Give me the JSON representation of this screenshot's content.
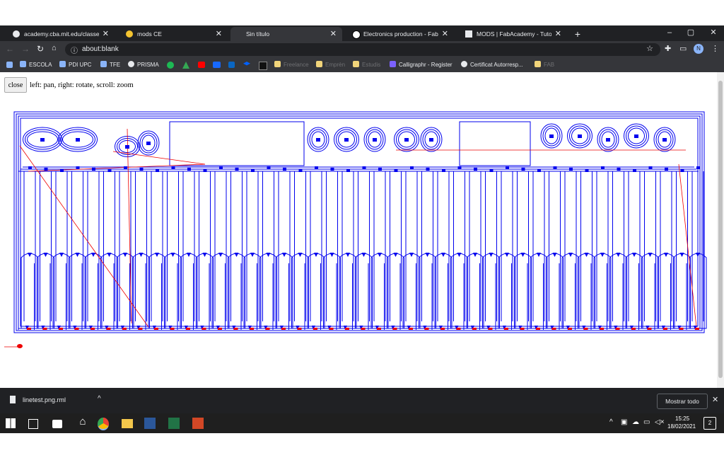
{
  "tabs": [
    {
      "title": "academy.cba.mit.edu/classes/ele"
    },
    {
      "title": "mods CE"
    },
    {
      "title": "Sin título"
    },
    {
      "title": "Electronics production - FabAcad"
    },
    {
      "title": "MODS | FabAcademy - Tutorials"
    }
  ],
  "omnibox": {
    "url": "about:blank"
  },
  "profile_initial": "N",
  "bookmarks": [
    {
      "label": "ESCOLA"
    },
    {
      "label": "PDI UPC"
    },
    {
      "label": "TFE"
    },
    {
      "label": "PRISMA"
    },
    {
      "label": "Freelance"
    },
    {
      "label": "Emprèn"
    },
    {
      "label": "Estudis"
    },
    {
      "label": "Calligraphr - Register"
    },
    {
      "label": "Certificat Autorresp..."
    },
    {
      "label": "FAB"
    }
  ],
  "page": {
    "close_label": "close",
    "hint": "left: pan, right: rotate, scroll: zoom"
  },
  "download": {
    "filename": "linetest.png.rml",
    "show_all": "Mostrar todo"
  },
  "taskbar": {
    "time": "15:25",
    "date": "18/02/2021",
    "notifications": "2"
  },
  "colors": {
    "toolpath": "#0000ee",
    "rapid_move": "#ee0000",
    "tabbar": "#202124",
    "toolbar": "#35363a"
  }
}
